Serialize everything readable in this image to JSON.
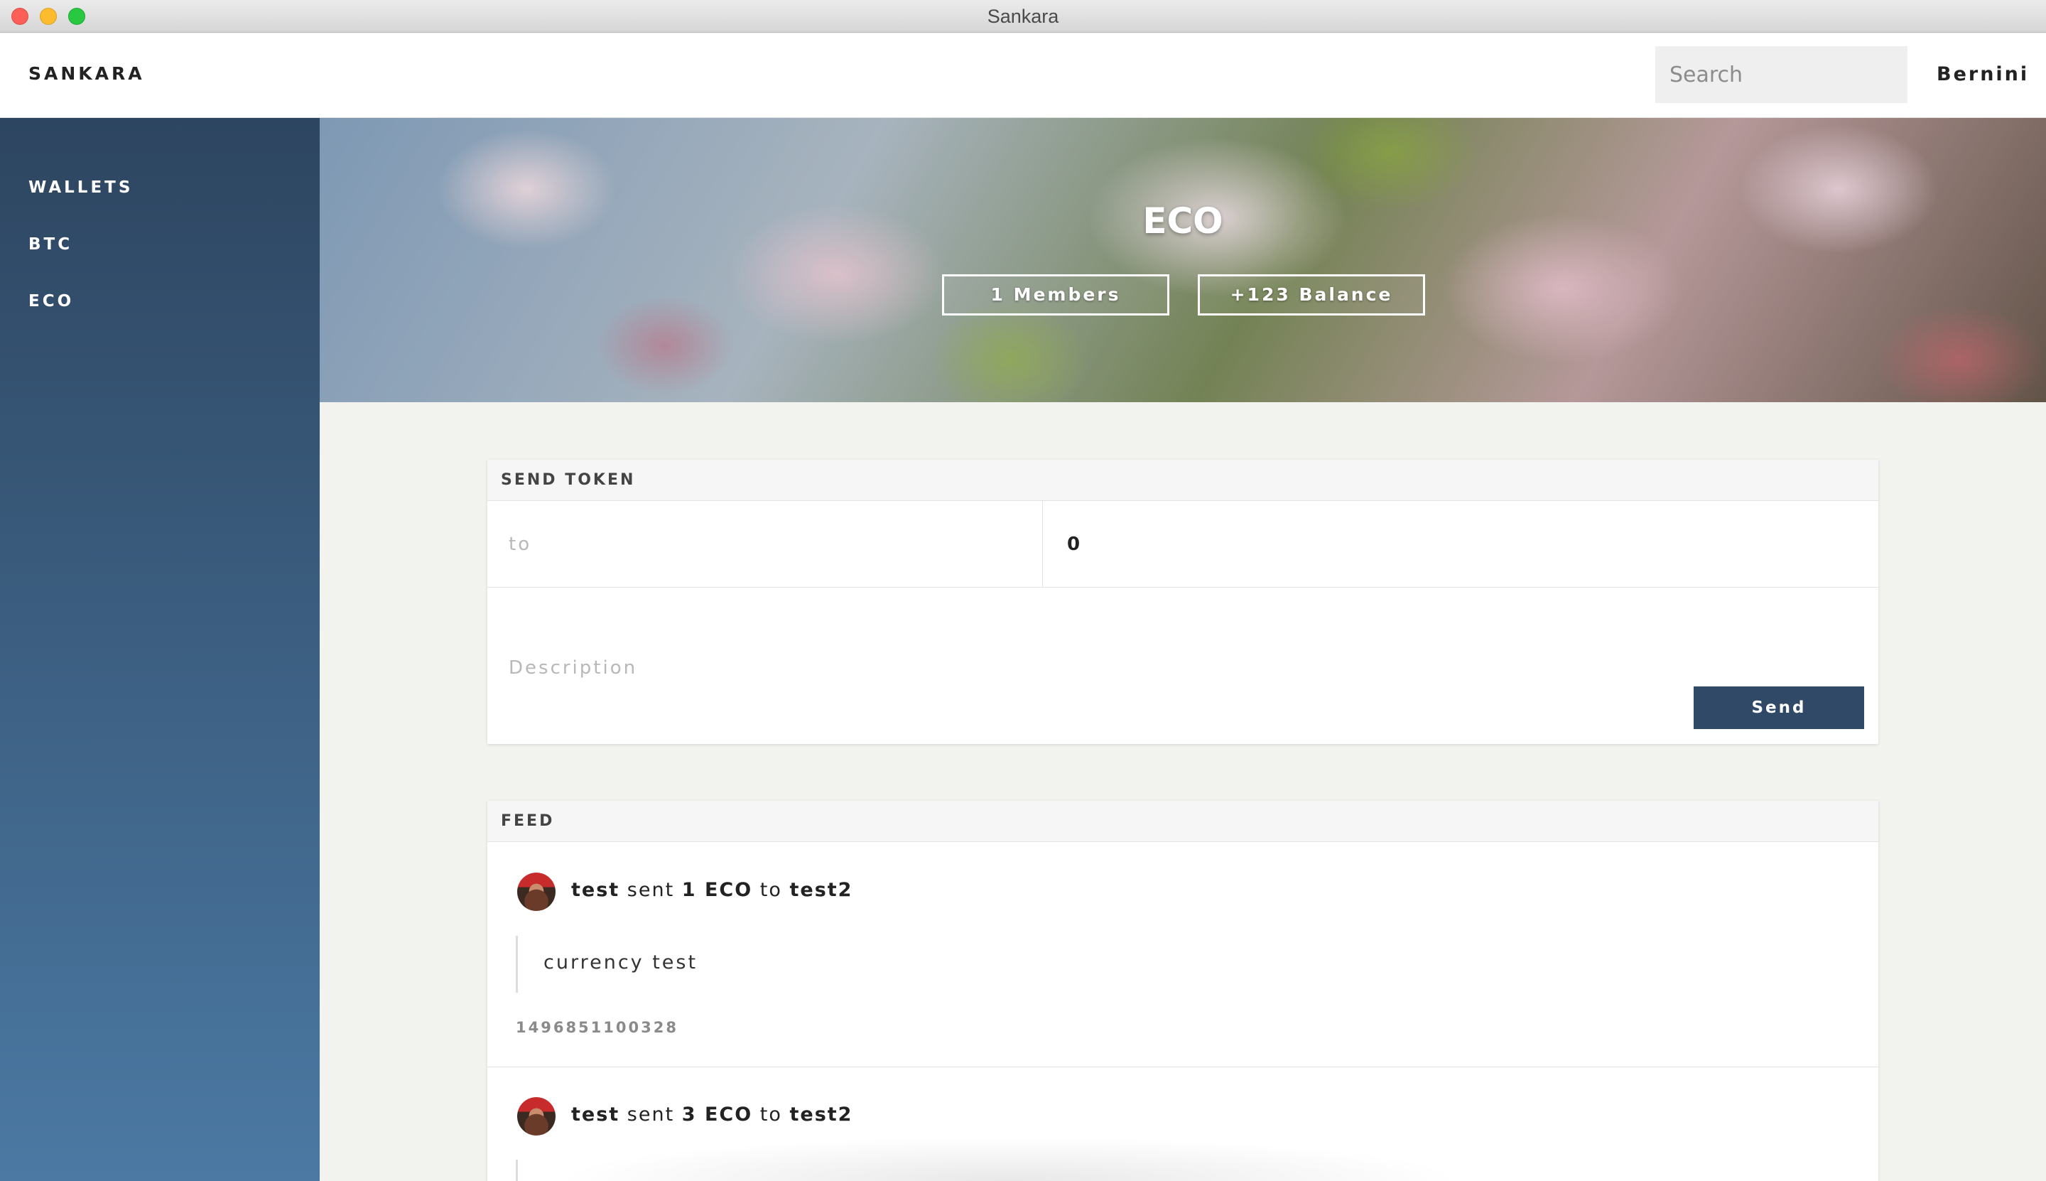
{
  "window": {
    "title": "Sankara"
  },
  "header": {
    "brand": "SANKARA",
    "search_placeholder": "Search",
    "user": "Bernini"
  },
  "sidebar": {
    "items": [
      {
        "label": "WALLETS"
      },
      {
        "label": "BTC"
      },
      {
        "label": "ECO"
      }
    ]
  },
  "hero": {
    "title": "ECO",
    "members": "1 Members",
    "balance": "+123 Balance"
  },
  "send": {
    "header": "SEND TOKEN",
    "to_placeholder": "to",
    "amount_value": "0",
    "description_placeholder": "Description",
    "send_label": "Send"
  },
  "feed": {
    "header": "FEED",
    "items": [
      {
        "from": "test",
        "verb": "sent",
        "amount": "1 ECO",
        "prep": "to",
        "to": "test2",
        "note": "currency test",
        "timestamp": "1496851100328"
      },
      {
        "from": "test",
        "verb": "sent",
        "amount": "3 ECO",
        "prep": "to",
        "to": "test2"
      }
    ]
  }
}
